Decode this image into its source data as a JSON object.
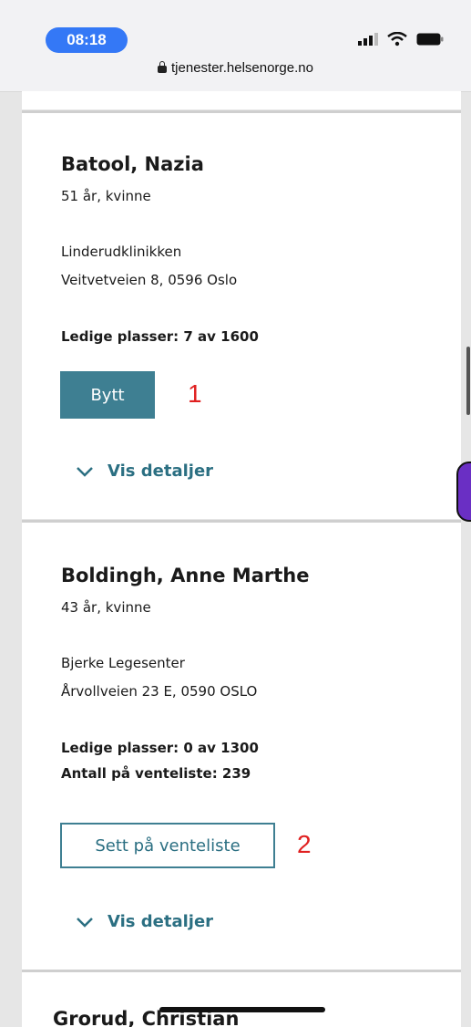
{
  "status": {
    "time": "08:18",
    "url": "tjenester.helsenorge.no"
  },
  "cards": [
    {
      "name": "Batool, Nazia",
      "age_gender": "51 år, kvinne",
      "clinic": "Linderudklinikken",
      "address": "Veitvetveien 8, 0596 Oslo",
      "capacity": "Ledige plasser: 7 av 1600",
      "button": "Bytt",
      "marker": "1",
      "details": "Vis detaljer"
    },
    {
      "name": "Boldingh, Anne Marthe",
      "age_gender": "43 år, kvinne",
      "clinic": "Bjerke Legesenter",
      "address": "Årvollveien 23 E, 0590 OSLO",
      "capacity": "Ledige plasser: 0 av 1300",
      "waitlist": "Antall på venteliste: 239",
      "button": "Sett på venteliste",
      "marker": "2",
      "details": "Vis detaljer"
    },
    {
      "name": "Grorud, Christian"
    }
  ],
  "colors": {
    "accent": "#3e7f92",
    "marker": "#e02020",
    "time_pill": "#3478f6"
  },
  "icons": [
    "lock-icon",
    "signal-icon",
    "wifi-icon",
    "battery-icon",
    "chevron-down-icon"
  ]
}
